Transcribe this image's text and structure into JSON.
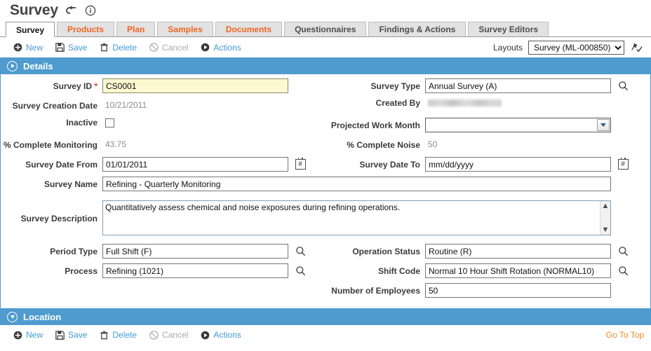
{
  "header": {
    "title": "Survey",
    "back_icon": "return-arrow-icon",
    "info_icon": "info-circle-icon"
  },
  "tabs": [
    {
      "label": "Survey",
      "state": "active",
      "style": "active"
    },
    {
      "label": "Products",
      "state": "inactive",
      "style": "orange"
    },
    {
      "label": "Plan",
      "state": "inactive",
      "style": "orange"
    },
    {
      "label": "Samples",
      "state": "inactive",
      "style": "orange"
    },
    {
      "label": "Documents",
      "state": "inactive",
      "style": "orange"
    },
    {
      "label": "Questionnaires",
      "state": "inactive",
      "style": "grey"
    },
    {
      "label": "Findings & Actions",
      "state": "inactive",
      "style": "grey"
    },
    {
      "label": "Survey Editors",
      "state": "inactive",
      "style": "grey"
    }
  ],
  "toolbar": {
    "new_label": "New",
    "save_label": "Save",
    "delete_label": "Delete",
    "cancel_label": "Cancel",
    "actions_label": "Actions",
    "layouts_label": "Layouts",
    "layout_selected": "Survey (ML-000850)",
    "pin_icon": "pushpin-check-icon"
  },
  "sections": {
    "details": {
      "title": "Details",
      "collapsed": true
    },
    "location": {
      "title": "Location",
      "collapsed": false
    }
  },
  "form": {
    "survey_id": {
      "label": "Survey ID",
      "required": "*",
      "value": "CS0001"
    },
    "survey_type": {
      "label": "Survey Type",
      "value": "Annual Survey (A)"
    },
    "survey_creation_date": {
      "label": "Survey Creation Date",
      "value": "10/21/2011"
    },
    "created_by": {
      "label": "Created By",
      "value": ""
    },
    "inactive": {
      "label": "Inactive",
      "checked": false
    },
    "projected_work_month": {
      "label": "Projected Work Month",
      "value": ""
    },
    "pct_complete_monitoring": {
      "label": "% Complete Monitoring",
      "value": "43.75"
    },
    "pct_complete_noise": {
      "label": "% Complete Noise",
      "value": "50"
    },
    "survey_date_from": {
      "label": "Survey Date From",
      "value": "01/01/2011"
    },
    "survey_date_to": {
      "label": "Survey Date To",
      "value": "",
      "placeholder": "mm/dd/yyyy"
    },
    "survey_name": {
      "label": "Survey Name",
      "value": "Refining - Quarterly Monitoring"
    },
    "survey_description": {
      "label": "Survey Description",
      "value": "Quantitatively assess chemical and noise exposures during refining operations."
    },
    "period_type": {
      "label": "Period Type",
      "value": "Full Shift (F)"
    },
    "operation_status": {
      "label": "Operation Status",
      "value": "Routine (R)"
    },
    "process": {
      "label": "Process",
      "value": "Refining (1021)"
    },
    "shift_code": {
      "label": "Shift Code",
      "value": "Normal 10 Hour Shift Rotation (NORMAL10)"
    },
    "number_of_employees": {
      "label": "Number of Employees",
      "value": "50"
    }
  },
  "footer": {
    "new_label": "New",
    "save_label": "Save",
    "delete_label": "Delete",
    "cancel_label": "Cancel",
    "actions_label": "Actions",
    "go_to_top_label": "Go To Top"
  },
  "colors": {
    "section_blue": "#4f9bcf",
    "tab_orange": "#f26522",
    "link_blue": "#3e9ad6",
    "required_red": "#e03a1e",
    "goto_top_orange": "#f08a24",
    "required_field_yellow": "#fcf8d0"
  }
}
